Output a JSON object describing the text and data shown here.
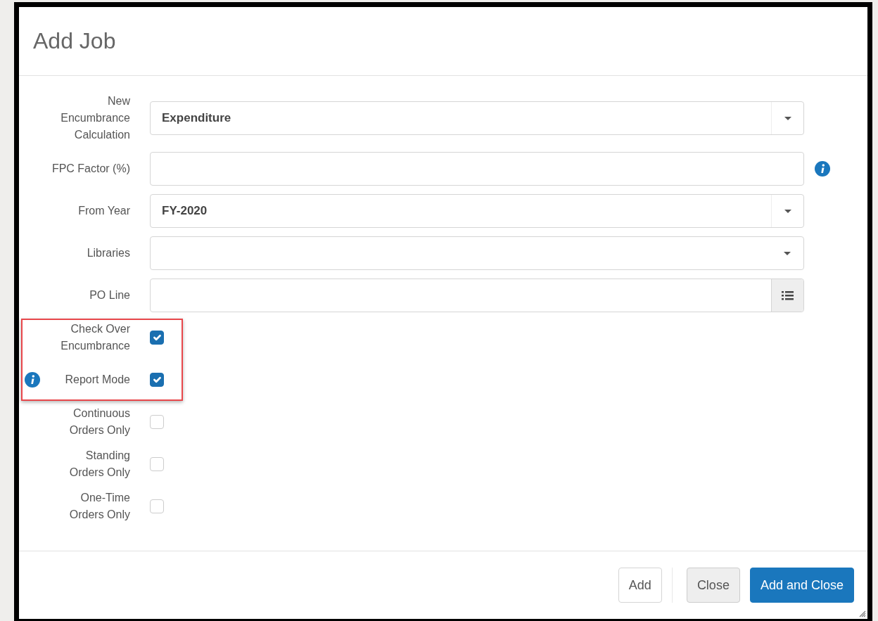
{
  "dialog": {
    "title": "Add Job"
  },
  "fields": [
    {
      "label": "New Encumbrance Calculation",
      "kind": "select",
      "value": "Expenditure",
      "info_icon": false
    },
    {
      "label": "FPC Factor (%)",
      "kind": "text",
      "info_icon": true
    },
    {
      "label": "From Year",
      "kind": "select",
      "value": "FY-2020",
      "info_icon": false
    },
    {
      "label": "Libraries",
      "kind": "select",
      "info_icon": false
    },
    {
      "label": "PO Line",
      "kind": "lookup",
      "info_icon": false
    }
  ],
  "checkboxes": [
    {
      "label": "Check Over Encumbrance",
      "checked": true,
      "highlighted": true,
      "info_icon": false
    },
    {
      "label": "Report Mode",
      "checked": true,
      "highlighted": true,
      "info_icon": true
    },
    {
      "label": "Continuous Orders Only",
      "checked": false,
      "highlighted": false,
      "info_icon": false
    },
    {
      "label": "Standing Orders Only",
      "checked": false,
      "highlighted": false,
      "info_icon": false
    },
    {
      "label": "One-Time Orders Only",
      "checked": false,
      "highlighted": false,
      "info_icon": false
    }
  ],
  "buttons": [
    {
      "label": "Add",
      "kind": "outline"
    },
    {
      "label": "Close",
      "kind": "secondary"
    },
    {
      "label": "Add and Close",
      "kind": "primary"
    }
  ]
}
